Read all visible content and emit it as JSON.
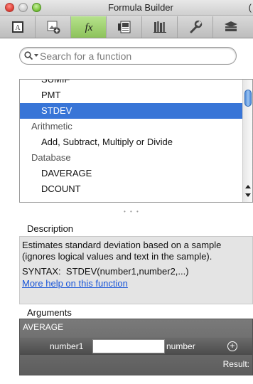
{
  "window": {
    "title": "Formula Builder",
    "edge_glyph": "("
  },
  "toolbar": {
    "buttons": [
      {
        "icon": "text-box-icon"
      },
      {
        "icon": "add-media-icon"
      },
      {
        "icon": "function-fx-icon",
        "label": "fx",
        "active": true
      },
      {
        "icon": "gallery-icon"
      },
      {
        "icon": "books-icon"
      },
      {
        "icon": "wrench-icon"
      },
      {
        "icon": "stack-icon"
      }
    ],
    "active_color": "#9fd170"
  },
  "search": {
    "placeholder": "Search for a function",
    "value": ""
  },
  "function_list": {
    "rows": [
      {
        "text": "SUMIF",
        "kind": "item"
      },
      {
        "text": "PMT",
        "kind": "item"
      },
      {
        "text": "STDEV",
        "kind": "item",
        "selected": true
      },
      {
        "text": "Arithmetic",
        "kind": "group"
      },
      {
        "text": "Add, Subtract, Multiply or Divide",
        "kind": "item"
      },
      {
        "text": "Database",
        "kind": "group"
      },
      {
        "text": "DAVERAGE",
        "kind": "item"
      },
      {
        "text": "DCOUNT",
        "kind": "item"
      }
    ],
    "selection_color": "#3875d7"
  },
  "splitter": "• • •",
  "description": {
    "label": "Description",
    "text": "Estimates standard deviation based on a sample (ignores logical values and text in the sample).",
    "syntax_label": "SYNTAX:",
    "syntax": "STDEV(number1,number2,...)",
    "help_link": "More help on this function"
  },
  "arguments": {
    "label": "Arguments",
    "function_name": "AVERAGE",
    "arg_name": "number1",
    "arg_value": "",
    "arg_type": "number",
    "add_symbol": "+",
    "result_label": "Result:"
  }
}
